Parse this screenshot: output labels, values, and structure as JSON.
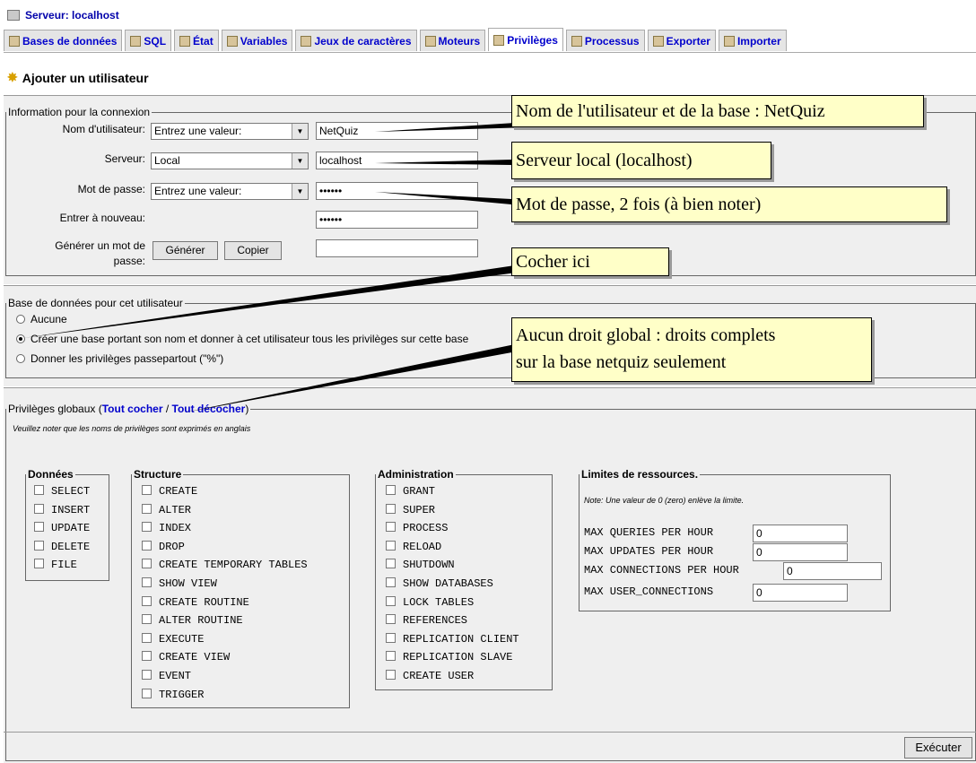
{
  "server_bar": {
    "label": "Serveur: localhost"
  },
  "tabs": [
    {
      "label": "Bases de données"
    },
    {
      "label": "SQL"
    },
    {
      "label": "État"
    },
    {
      "label": "Variables"
    },
    {
      "label": "Jeux de caractères"
    },
    {
      "label": "Moteurs"
    },
    {
      "label": "Privilèges",
      "active": true
    },
    {
      "label": "Processus"
    },
    {
      "label": "Exporter"
    },
    {
      "label": "Importer"
    }
  ],
  "page_title": "Ajouter un utilisateur",
  "login": {
    "legend": "Information pour la connexion",
    "username_label": "Nom d'utilisateur:",
    "username_select": "Entrez une valeur:",
    "username_value": "NetQuiz",
    "host_label": "Serveur:",
    "host_select": "Local",
    "host_value": "localhost",
    "password_label": "Mot de passe:",
    "password_select": "Entrez une valeur:",
    "password_value": "••••••",
    "retype_label": "Entrer à nouveau:",
    "retype_value": "••••••",
    "generate_label_1": "Générer un mot de",
    "generate_label_2": "passe:",
    "generate_button": "Générer",
    "copy_button": "Copier"
  },
  "database": {
    "legend": "Base de données pour cet utilisateur",
    "options": [
      {
        "label": "Aucune",
        "checked": false
      },
      {
        "label": "Créer une base portant son nom et donner à cet utilisateur tous les privilèges sur cette base",
        "checked": true
      },
      {
        "label": "Donner les privilèges passepartout (\"%\")",
        "checked": false
      }
    ]
  },
  "privileges": {
    "legend_prefix": "Privilèges globaux (",
    "check_all": "Tout cocher",
    "separator": " / ",
    "uncheck_all": "Tout décocher",
    "legend_suffix": ")",
    "note": "Veuillez noter que les noms de privilèges sont exprimés en anglais",
    "data": {
      "legend": "Données",
      "items": [
        "SELECT",
        "INSERT",
        "UPDATE",
        "DELETE",
        "FILE"
      ]
    },
    "structure": {
      "legend": "Structure",
      "items": [
        "CREATE",
        "ALTER",
        "INDEX",
        "DROP",
        "CREATE TEMPORARY TABLES",
        "SHOW VIEW",
        "CREATE ROUTINE",
        "ALTER ROUTINE",
        "EXECUTE",
        "CREATE VIEW",
        "EVENT",
        "TRIGGER"
      ]
    },
    "admin": {
      "legend": "Administration",
      "items": [
        "GRANT",
        "SUPER",
        "PROCESS",
        "RELOAD",
        "SHUTDOWN",
        "SHOW DATABASES",
        "LOCK TABLES",
        "REFERENCES",
        "REPLICATION CLIENT",
        "REPLICATION SLAVE",
        "CREATE USER"
      ]
    },
    "limits": {
      "legend": "Limites de ressources.",
      "note": "Note: Une valeur de 0 (zero) enlève la limite.",
      "rows": [
        {
          "label": "MAX QUERIES PER HOUR",
          "value": "0"
        },
        {
          "label": "MAX UPDATES PER HOUR",
          "value": "0"
        },
        {
          "label": "MAX CONNECTIONS PER HOUR",
          "value": "0"
        },
        {
          "label": "MAX USER_CONNECTIONS",
          "value": "0"
        }
      ]
    }
  },
  "submit_button": "Exécuter",
  "callouts": {
    "name": "Nom de l'utilisateur et de la base : NetQuiz",
    "server": "Serveur local (localhost)",
    "password": "Mot de passe, 2 fois (à bien noter)",
    "check": "Cocher ici",
    "nodroit_1": "Aucun droit global : droits complets",
    "nodroit_2": "sur la base netquiz seulement"
  }
}
